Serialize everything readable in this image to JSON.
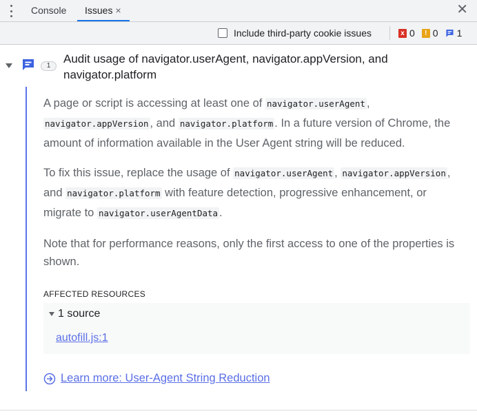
{
  "tabs": [
    {
      "label": "Console"
    },
    {
      "label": "Issues",
      "close": "×"
    }
  ],
  "close_panel": "✕",
  "filter": {
    "checkbox_label": "Include third-party cookie issues",
    "checked": false
  },
  "counts": {
    "errors": "0",
    "warnings": "0",
    "info": "1",
    "error_glyph": "x",
    "warning_glyph": "!"
  },
  "colors": {
    "accent": "#1a73e8",
    "error": "#d93025",
    "warning": "#e8a317",
    "info": "#3c62e0",
    "link": "#5b6fe6"
  },
  "issue": {
    "count": "1",
    "title": "Audit usage of navigator.userAgent, navigator.appVersion, and navigator.platform",
    "p1": [
      {
        "t": "A page or script is accessing at least one of "
      },
      {
        "c": "navigator.userAgent"
      },
      {
        "t": ", "
      },
      {
        "c": "navigator.appVersion"
      },
      {
        "t": ", and "
      },
      {
        "c": "navigator.platform"
      },
      {
        "t": ". In a future version of Chrome, the amount of information available in the User Agent string will be reduced."
      }
    ],
    "p2": [
      {
        "t": "To fix this issue, replace the usage of "
      },
      {
        "c": "navigator.userAgent"
      },
      {
        "t": ", "
      },
      {
        "c": "navigator.appVersion"
      },
      {
        "t": ", and "
      },
      {
        "c": "navigator.platform"
      },
      {
        "t": " with feature detection, progressive enhancement, or migrate to "
      },
      {
        "c": "navigator.userAgentData"
      },
      {
        "t": "."
      }
    ],
    "p3": "Note that for performance reasons, only the first access to one of the properties is shown.",
    "affected_heading": "AFFECTED RESOURCES",
    "sources_label": "1 source",
    "source_link": "autofill.js:1",
    "learn_more": "Learn more: User-Agent String Reduction"
  }
}
